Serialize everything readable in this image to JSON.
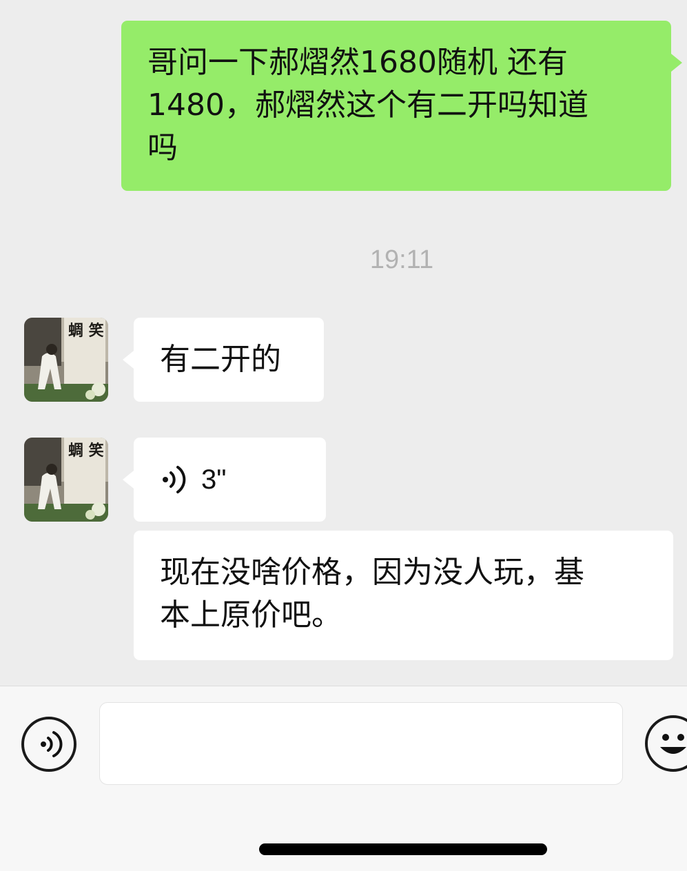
{
  "conversation": {
    "messages": [
      {
        "direction": "outgoing",
        "type": "text",
        "lines": [
          "哥问一下郝熠然1680随机 还有",
          "1480，郝熠然这个有二开吗知道",
          "吗"
        ]
      },
      {
        "type": "timestamp",
        "text": "19:11"
      },
      {
        "direction": "incoming",
        "type": "text",
        "lines": [
          "有二开的"
        ]
      },
      {
        "direction": "incoming",
        "type": "voice",
        "duration": "3\"",
        "icon": "voice-wave-icon"
      },
      {
        "direction": "incoming",
        "type": "text",
        "lines": [
          "现在没啥价格，因为没人玩，基",
          "本上原价吧。"
        ]
      }
    ]
  },
  "contact": {
    "avatar_text": "蜩 笑"
  },
  "input_bar": {
    "value": "",
    "voice_icon": "voice-toggle-icon",
    "emoji_icon": "emoji-icon"
  },
  "colors": {
    "outgoing_bubble": "#95ec69",
    "incoming_bubble": "#ffffff",
    "background": "#ededed",
    "timestamp": "#b2b2b2"
  }
}
